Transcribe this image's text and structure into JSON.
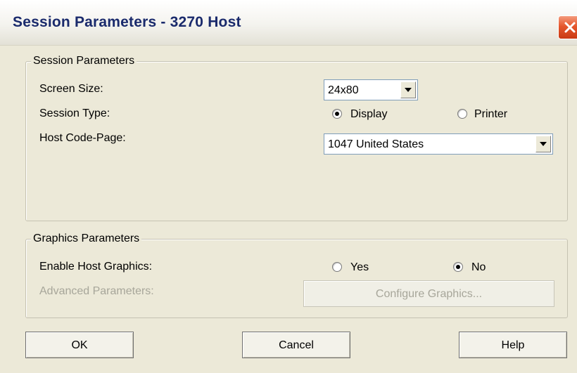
{
  "window": {
    "title": "Session Parameters - 3270 Host"
  },
  "session_group": {
    "legend": "Session Parameters",
    "screen_size": {
      "label": "Screen Size:",
      "value": "24x80"
    },
    "session_type": {
      "label": "Session Type:",
      "options": [
        {
          "label": "Display",
          "selected": true
        },
        {
          "label": "Printer",
          "selected": false
        }
      ]
    },
    "host_code_page": {
      "label": "Host Code-Page:",
      "value": "1047 United States"
    }
  },
  "graphics_group": {
    "legend": "Graphics Parameters",
    "enable_host_graphics": {
      "label": "Enable Host Graphics:",
      "options": [
        {
          "label": "Yes",
          "selected": false
        },
        {
          "label": "No",
          "selected": true
        }
      ]
    },
    "advanced": {
      "label": "Advanced Parameters:",
      "button_label": "Configure Graphics..."
    }
  },
  "buttons": {
    "ok": "OK",
    "cancel": "Cancel",
    "help": "Help"
  },
  "icons": {
    "close": "close-icon",
    "dropdown": "chevron-down-icon"
  },
  "colors": {
    "title_text": "#1a2a6c",
    "close_button": "#e5572d",
    "dialog_background": "#ece9d8",
    "disabled_text": "#a7a69a"
  }
}
